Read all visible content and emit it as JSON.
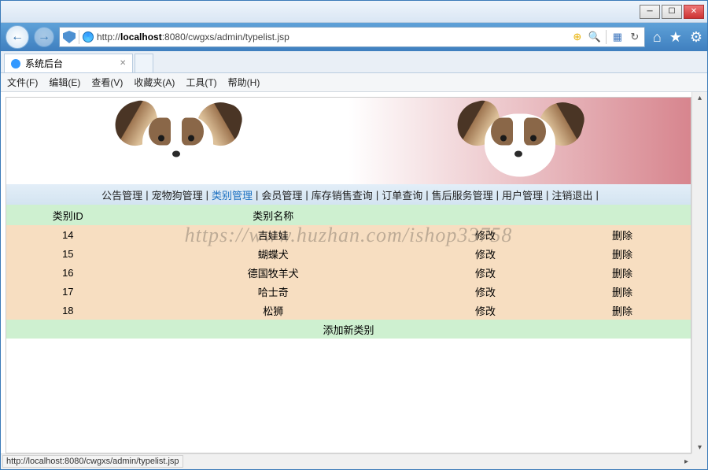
{
  "window": {
    "url_prefix": "http://",
    "url_host": "localhost",
    "url_rest": ":8080/cwgxs/admin/typelist.jsp",
    "tab_title": "系统后台",
    "status_url": "http://localhost:8080/cwgxs/admin/typelist.jsp"
  },
  "menubar": {
    "file": "文件(F)",
    "edit": "编辑(E)",
    "view": "查看(V)",
    "favorites": "收藏夹(A)",
    "tools": "工具(T)",
    "help": "帮助(H)"
  },
  "nav": {
    "items": [
      {
        "label": "公告管理",
        "active": false
      },
      {
        "label": "宠物狗管理",
        "active": false
      },
      {
        "label": "类别管理",
        "active": true
      },
      {
        "label": "会员管理",
        "active": false
      },
      {
        "label": "库存销售查询",
        "active": false
      },
      {
        "label": "订单查询",
        "active": false
      },
      {
        "label": "售后服务管理",
        "active": false
      },
      {
        "label": "用户管理",
        "active": false
      },
      {
        "label": "注销退出",
        "active": false
      }
    ]
  },
  "table": {
    "col_id": "类别ID",
    "col_name": "类别名称",
    "edit_label": "修改",
    "delete_label": "删除",
    "rows": [
      {
        "id": "14",
        "name": "吉娃娃"
      },
      {
        "id": "15",
        "name": "蝴蝶犬"
      },
      {
        "id": "16",
        "name": "德国牧羊犬"
      },
      {
        "id": "17",
        "name": "哈士奇"
      },
      {
        "id": "18",
        "name": "松狮"
      }
    ],
    "add_label": "添加新类别"
  },
  "watermark": "https://www.huzhan.com/ishop33758"
}
